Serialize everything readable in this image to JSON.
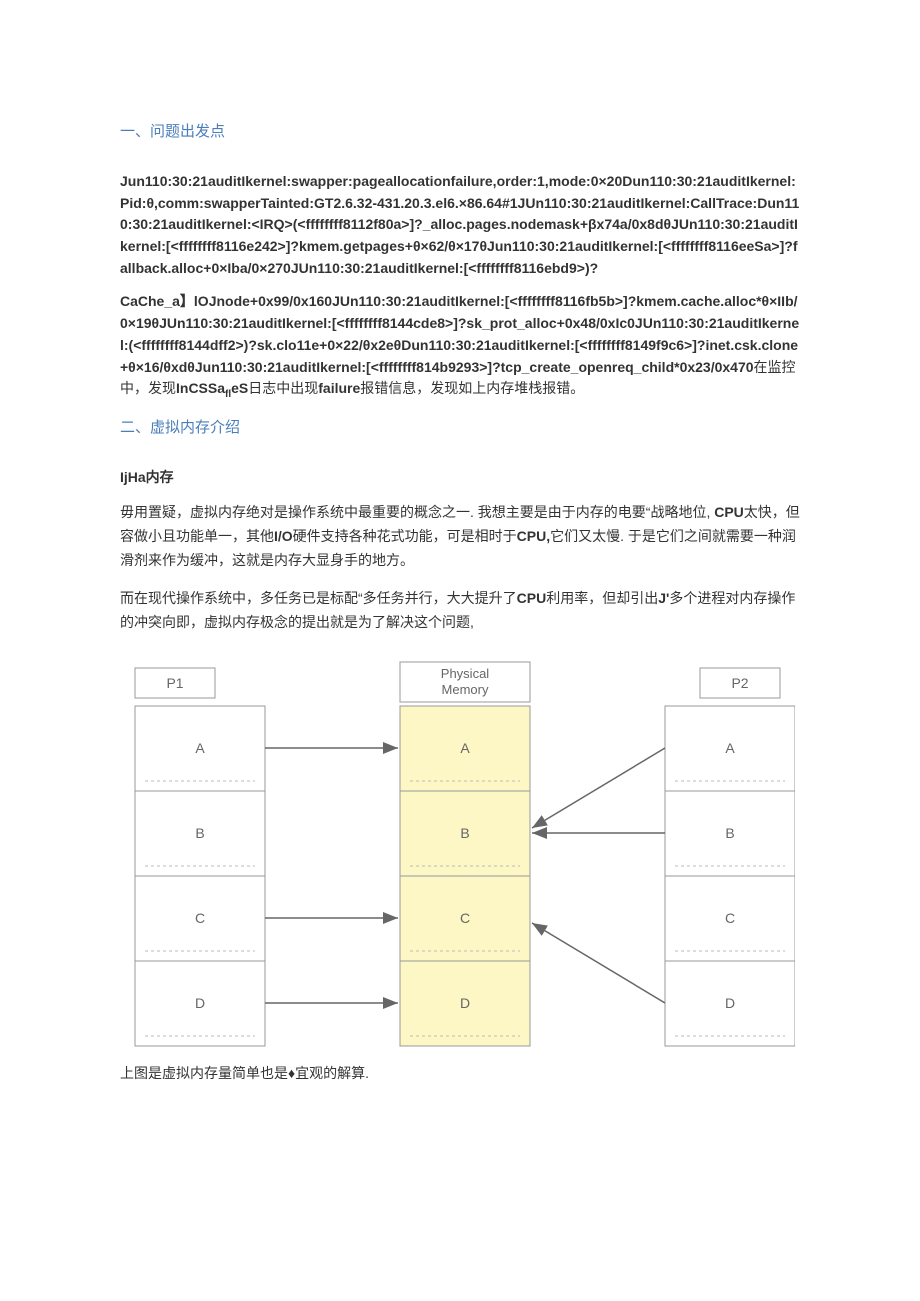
{
  "section1": {
    "heading": "一、问题出发点",
    "codeblock1": "Jun110:30:21auditIkernel:swapper:pageallocationfailure,order:1,mode:0×20Dun110:30:21auditIkernel:Pid:θ,comm:swapperTainted:GT2.6.32-431.20.3.el6.×86.64#1JUn110:30:21auditIkernel:CallTrace:Dun110:30:21auditIkernel:<IRQ>(<ffffffff8112f80a>]?_alloc.pages.nodemask+βx74a/0x8dθJUn110:30:21auditIkernel:[<ffffffff8116e242>]?kmem.getpages+θ×62/θ×17θJun110:30:21auditIkernel:[<ffffffff8116eeSa>]?fallback.alloc+0×Iba/0×270JUn110:30:21auditIkernel:[<ffffffff8116ebd9>)?",
    "codeblock2": "CaChe_a】lOJnode+0x99/0x160JUn110:30:21auditIkernel:[<ffffffff8116fb5b>]?kmem.cache.alloc*θ×IIb/0×19θJUn110:30:21auditIkernel:[<ffffffff8144cde8>]?sk_prot_alloc+0x48/0xIc0JUn110:30:21auditIkernel:(<ffffffff8144dff2>)?sk.clo11e+0×22/θx2eθDun110:30:21auditIkernel:[<ffffffff8149f9c6>]?inet.csk.clone+θ×16/θxdθJun110:30:21auditIkernel:[<ffffffff814b9293>]?tcp_create_openreq_child*0x23/0x470",
    "tail1": "在监控中，发现",
    "tail2": "InCSSa",
    "tail_sub": "fl",
    "tail3": "eS",
    "tail4": "日志中出现",
    "tail5": "failure",
    "tail6": "报错信息，发现如上内存堆栈报错。"
  },
  "section2": {
    "heading": "二、虚拟内存介绍",
    "subheading": "IjHa内存",
    "para1_pre": "毋用置疑，虚拟内存绝对是操作系统中最重要的概念之一. 我想主要是由于内存的电要“战略地位, ",
    "para1_b1": "CPU",
    "para1_mid1": "太快，但容做小且功能单一，其他",
    "para1_b2": "I/O",
    "para1_mid2": "硬件支持各种花式功能，可是相时于",
    "para1_b3": "CPU,",
    "para1_end": "它们又太慢. 于是它们之间就需要一种润滑剂来作为缓冲，这就是内存大显身手的地方。",
    "para2_pre": "而在现代操作系统中，多任务已是标配“多任务并行，大大提升了",
    "para2_b1": "CPU",
    "para2_mid": "利用率，但却引出",
    "para2_b2": "J'",
    "para2_end": "多个进程对内存操作的冲突向即，虚拟内存极念的提出就是为了解决这个问题,"
  },
  "diagram": {
    "p1": "P1",
    "p2": "P2",
    "center_title": "Physical\nMemory",
    "labels": [
      "A",
      "B",
      "C",
      "D"
    ],
    "caption": "上图是虚拟内存量简单也是♦宜观的解算."
  }
}
